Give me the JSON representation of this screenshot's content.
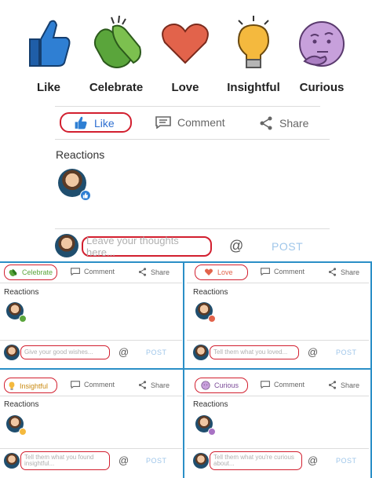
{
  "legend": {
    "items": [
      {
        "label": "Like",
        "icon": "thumbs-up-icon",
        "color": "#2f7fd3"
      },
      {
        "label": "Celebrate",
        "icon": "clapping-hands-icon",
        "color": "#5aa53b"
      },
      {
        "label": "Love",
        "icon": "heart-icon",
        "color": "#e2634b"
      },
      {
        "label": "Insightful",
        "icon": "lightbulb-icon",
        "color": "#f4b93e"
      },
      {
        "label": "Curious",
        "icon": "thinking-face-icon",
        "color": "#c7a0db"
      }
    ]
  },
  "main_card": {
    "actions": {
      "like": "Like",
      "comment": "Comment",
      "share": "Share"
    },
    "reactions_title": "Reactions",
    "comment_placeholder": "Leave your thoughts here...",
    "at_symbol": "@",
    "post_label": "POST"
  },
  "cards": [
    {
      "reaction": "Celebrate",
      "comment": "Comment",
      "share": "Share",
      "reactions_title": "Reactions",
      "placeholder": "Give your good wishes...",
      "at_symbol": "@",
      "post_label": "POST",
      "color": "#5aa53b"
    },
    {
      "reaction": "Love",
      "comment": "Comment",
      "share": "Share",
      "reactions_title": "Reactions",
      "placeholder": "Tell them what you loved...",
      "at_symbol": "@",
      "post_label": "POST",
      "color": "#e2634b"
    },
    {
      "reaction": "Insightful",
      "comment": "Comment",
      "share": "Share",
      "reactions_title": "Reactions",
      "placeholder": "Tell them what you found insightful...",
      "at_symbol": "@",
      "post_label": "POST",
      "color": "#f4b93e"
    },
    {
      "reaction": "Curious",
      "comment": "Comment",
      "share": "Share",
      "reactions_title": "Reactions",
      "placeholder": "Tell them what you're curious about...",
      "at_symbol": "@",
      "post_label": "POST",
      "color": "#a872c4"
    }
  ],
  "colors": {
    "active_blue": "#2e6fd1",
    "highlight_red": "#d21f2f",
    "divider_blue": "#2b8fc7",
    "post_disabled": "#9fc6ea"
  }
}
